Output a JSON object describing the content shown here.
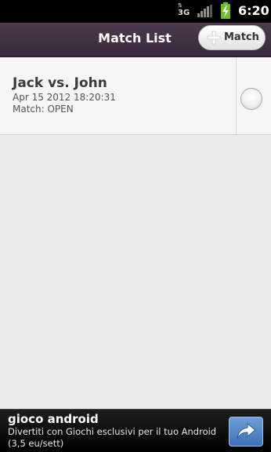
{
  "status_bar": {
    "network": "3G",
    "time": "6:20",
    "icons": [
      "3g-data-icon",
      "signal-icon",
      "battery-charging-icon"
    ]
  },
  "title_bar": {
    "title": "Match List",
    "new_match_label": "Match",
    "new_match_icon": "plus-icon"
  },
  "matches": [
    {
      "title": "Jack vs. John",
      "date": "Apr 15 2012 18:20:31",
      "status": "Match: OPEN",
      "selected": false
    }
  ],
  "ad": {
    "title": "gioco android",
    "body": "Divertiti con Giochi esclusivi per il tuo Android (3,5 eu/sett)",
    "button_icon": "share-arrow-icon"
  },
  "colors": {
    "title_bar": "#3d2f40",
    "list_background": "#ececec",
    "row_background": "#f5f5f5",
    "battery": "#6fbf27",
    "ad_button": "#4a7dc2"
  }
}
